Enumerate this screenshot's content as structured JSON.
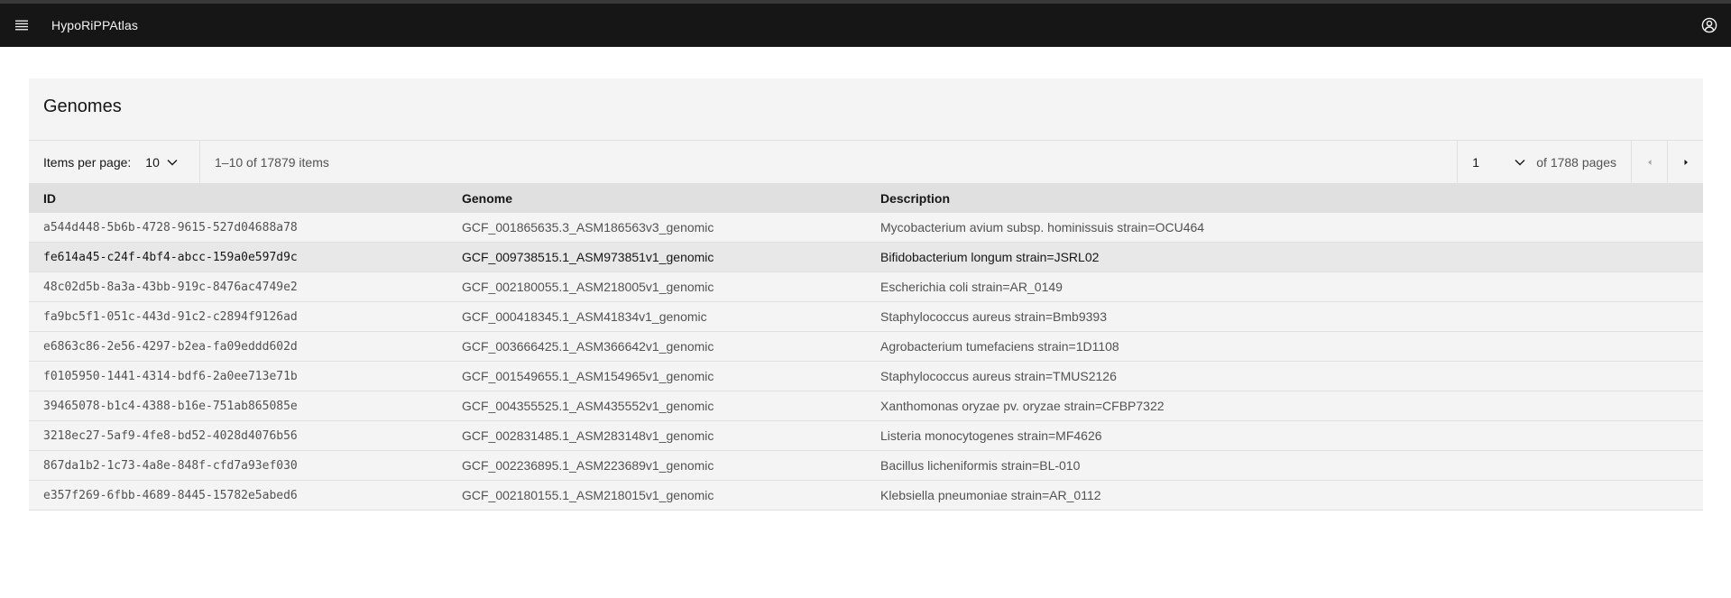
{
  "header": {
    "app_title": "HypoRiPPAtlas",
    "menu_icon": "hamburger-menu-icon",
    "user_icon": "user-avatar-icon"
  },
  "colors": {
    "header_bg": "#161616",
    "tile_bg": "#f4f4f4",
    "table_header_bg": "#e0e0e0",
    "row_highlight_bg": "#e8e8e8"
  },
  "panel": {
    "title": "Genomes"
  },
  "pagination": {
    "items_per_page_label": "Items per page:",
    "items_per_page_value": "10",
    "range_text": "1–10 of 17879 items",
    "current_page": "1",
    "of_pages_text": "of 1788 pages"
  },
  "table": {
    "headers": [
      "ID",
      "Genome",
      "Description"
    ],
    "rows": [
      [
        "a544d448-5b6b-4728-9615-527d04688a78",
        "GCF_001865635.3_ASM186563v3_genomic",
        "Mycobacterium avium subsp. hominissuis strain=OCU464"
      ],
      [
        "fe614a45-c24f-4bf4-abcc-159a0e597d9c",
        "GCF_009738515.1_ASM973851v1_genomic",
        "Bifidobacterium longum strain=JSRL02"
      ],
      [
        "48c02d5b-8a3a-43bb-919c-8476ac4749e2",
        "GCF_002180055.1_ASM218005v1_genomic",
        "Escherichia coli strain=AR_0149"
      ],
      [
        "fa9bc5f1-051c-443d-91c2-c2894f9126ad",
        "GCF_000418345.1_ASM41834v1_genomic",
        "Staphylococcus aureus strain=Bmb9393"
      ],
      [
        "e6863c86-2e56-4297-b2ea-fa09eddd602d",
        "GCF_003666425.1_ASM366642v1_genomic",
        "Agrobacterium tumefaciens strain=1D1108"
      ],
      [
        "f0105950-1441-4314-bdf6-2a0ee713e71b",
        "GCF_001549655.1_ASM154965v1_genomic",
        "Staphylococcus aureus strain=TMUS2126"
      ],
      [
        "39465078-b1c4-4388-b16e-751ab865085e",
        "GCF_004355525.1_ASM435552v1_genomic",
        "Xanthomonas oryzae pv. oryzae strain=CFBP7322"
      ],
      [
        "3218ec27-5af9-4fe8-bd52-4028d4076b56",
        "GCF_002831485.1_ASM283148v1_genomic",
        "Listeria monocytogenes strain=MF4626"
      ],
      [
        "867da1b2-1c73-4a8e-848f-cfd7a93ef030",
        "GCF_002236895.1_ASM223689v1_genomic",
        "Bacillus licheniformis strain=BL-010"
      ],
      [
        "e357f269-6fbb-4689-8445-15782e5abed6",
        "GCF_002180155.1_ASM218015v1_genomic",
        "Klebsiella pneumoniae strain=AR_0112"
      ]
    ],
    "highlighted_row": 1
  }
}
